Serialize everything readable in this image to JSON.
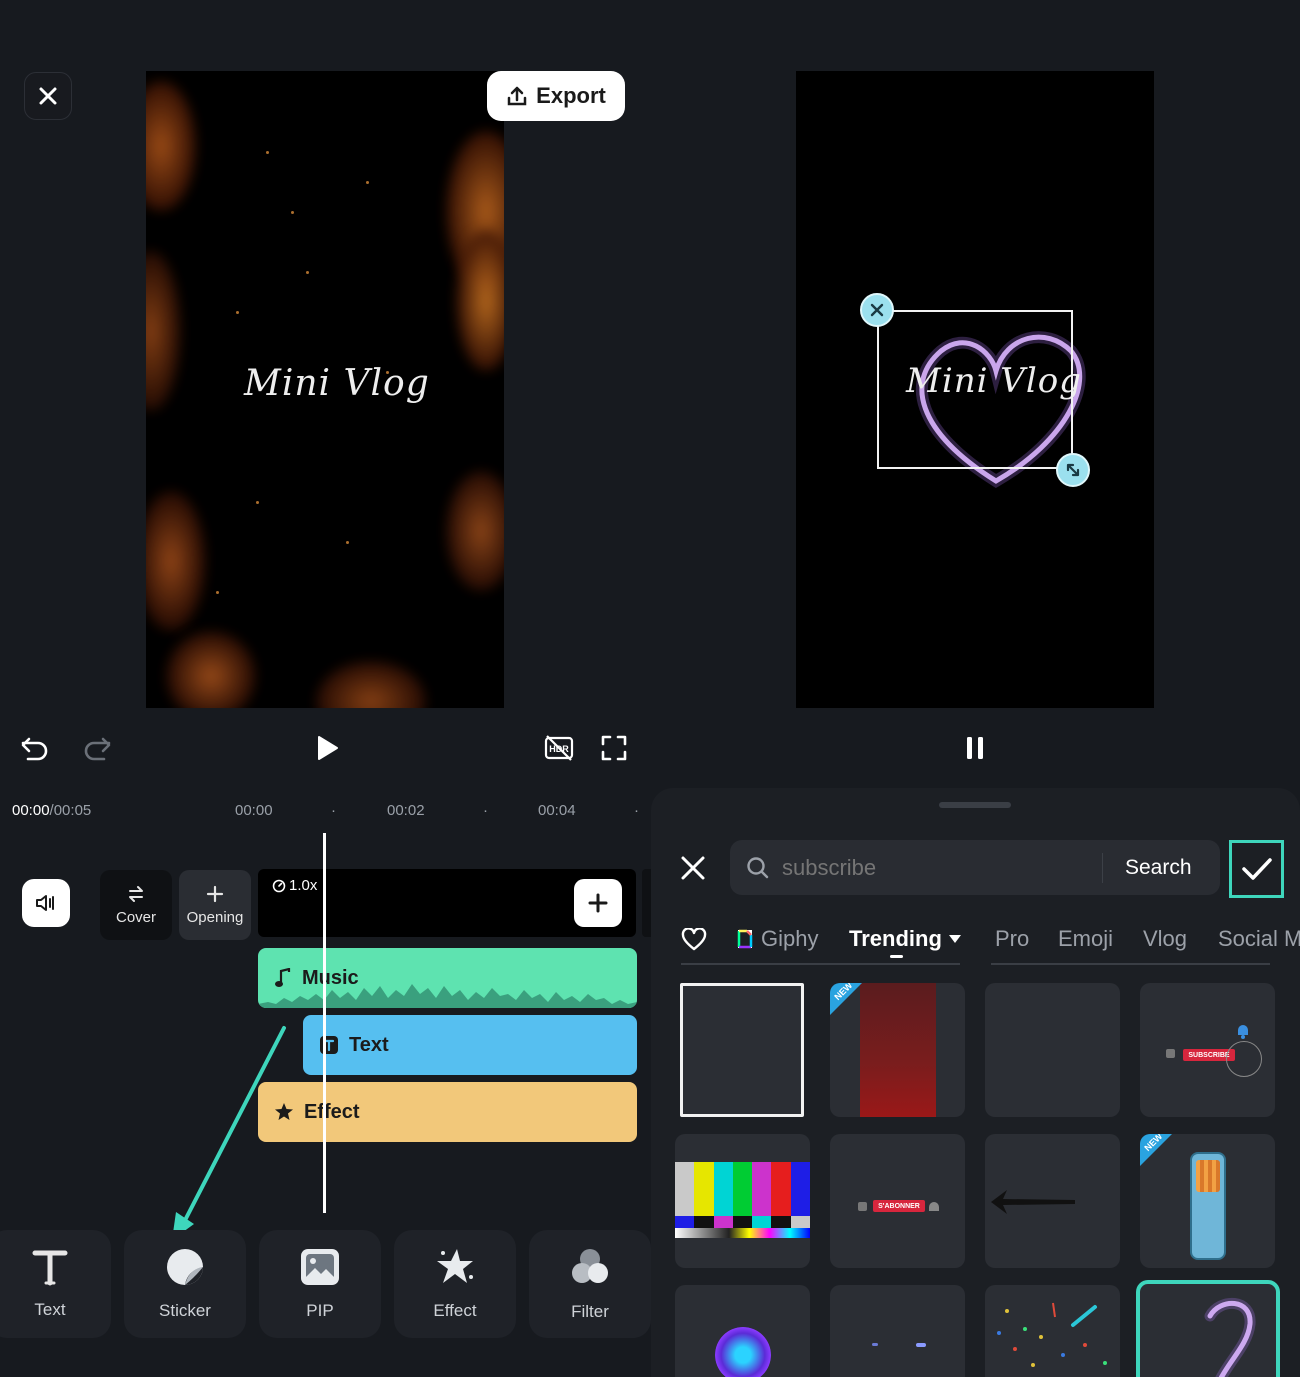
{
  "top": {
    "export_label": "Export",
    "left_preview_title": "Mini Vlog",
    "right_preview_title": "Mini Vlog"
  },
  "timeline": {
    "current_time": "00:00",
    "total_time": "/00:05",
    "ticks": [
      "00:00",
      "00:02",
      "00:04"
    ],
    "speed": "1.0x",
    "cover_label": "Cover",
    "opening_label": "Opening",
    "tracks": {
      "music": "Music",
      "text": "Text",
      "effect": "Effect"
    }
  },
  "toolbar": {
    "items": [
      {
        "label": "Text"
      },
      {
        "label": "Sticker"
      },
      {
        "label": "PIP"
      },
      {
        "label": "Effect"
      },
      {
        "label": "Filter"
      }
    ]
  },
  "sticker_panel": {
    "search": {
      "placeholder": "subscribe",
      "button": "Search"
    },
    "tabs": [
      "Giphy",
      "Trending",
      "Pro",
      "Emoji",
      "Vlog",
      "Social M"
    ],
    "active_tab": "Trending",
    "subscribe_sticker_text": "SUBSCRIBE",
    "sabonner_sticker_text": "S'ABONNER",
    "new_badge": "NEW"
  },
  "colors": {
    "accent": "#3ed6bc",
    "music_track": "#5ee3b0",
    "text_track": "#56bff0",
    "effect_track": "#f2c87a",
    "background": "#171a1f"
  }
}
